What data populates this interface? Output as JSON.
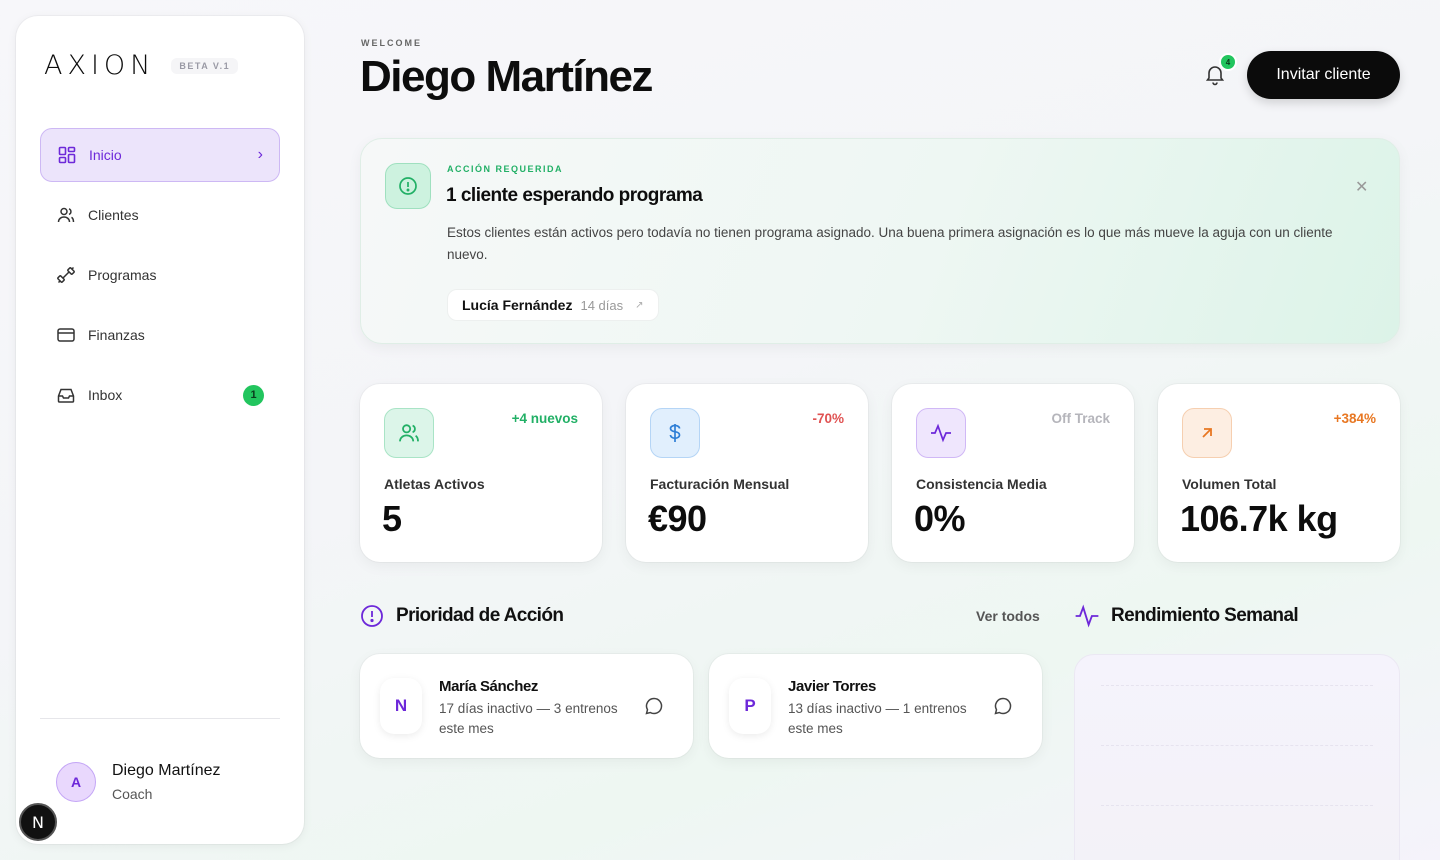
{
  "sidebar": {
    "logo": "AXION",
    "beta": "BETA V.1",
    "items": [
      {
        "label": "Inicio",
        "icon": "grid-icon",
        "active": true
      },
      {
        "label": "Clientes",
        "icon": "users-icon"
      },
      {
        "label": "Programas",
        "icon": "dumbbell-icon"
      },
      {
        "label": "Finanzas",
        "icon": "card-icon"
      },
      {
        "label": "Inbox",
        "icon": "inbox-icon",
        "badge": "1"
      }
    ],
    "user": {
      "initial": "A",
      "name": "Diego Martínez",
      "role": "Coach"
    },
    "dev_badge": "N"
  },
  "header": {
    "welcome": "WELCOME",
    "title": "Diego Martínez",
    "notifications": "4",
    "invite_label": "Invitar cliente"
  },
  "alert": {
    "tag": "ACCIÓN REQUERIDA",
    "title": "1 cliente esperando programa",
    "description": "Estos clientes están activos pero todavía no tienen programa asignado. Una buena primera asignación es lo que más mueve la aguja con un cliente nuevo.",
    "client": {
      "name": "Lucía Fernández",
      "days": "14 días"
    }
  },
  "stats": [
    {
      "label": "Atletas Activos",
      "value": "5",
      "tag": "+4 nuevos",
      "tag_color": "#22b066",
      "icon": "users-icon"
    },
    {
      "label": "Facturación Mensual",
      "value": "€90",
      "tag": "-70%",
      "tag_color": "#e05252",
      "icon": "dollar-icon"
    },
    {
      "label": "Consistencia Media",
      "value": "0%",
      "tag": "Off Track",
      "tag_color": "#b5b5bb",
      "icon": "activity-icon"
    },
    {
      "label": "Volumen Total",
      "value": "106.7k kg",
      "tag": "+384%",
      "tag_color": "#e87722",
      "icon": "arrow-up-right-icon"
    }
  ],
  "priority": {
    "title": "Prioridad de Acción",
    "view_all": "Ver todos",
    "cards": [
      {
        "initial": "N",
        "name": "María Sánchez",
        "desc": "17 días inactivo — 3 entrenos este mes"
      },
      {
        "initial": "P",
        "name": "Javier Torres",
        "desc": "13 días inactivo — 1 entrenos este mes"
      }
    ]
  },
  "performance": {
    "title": "Rendimiento Semanal"
  },
  "colors": {
    "accent": "#6d28d9",
    "success": "#22c55e",
    "active_bg": "#ece4fb"
  }
}
